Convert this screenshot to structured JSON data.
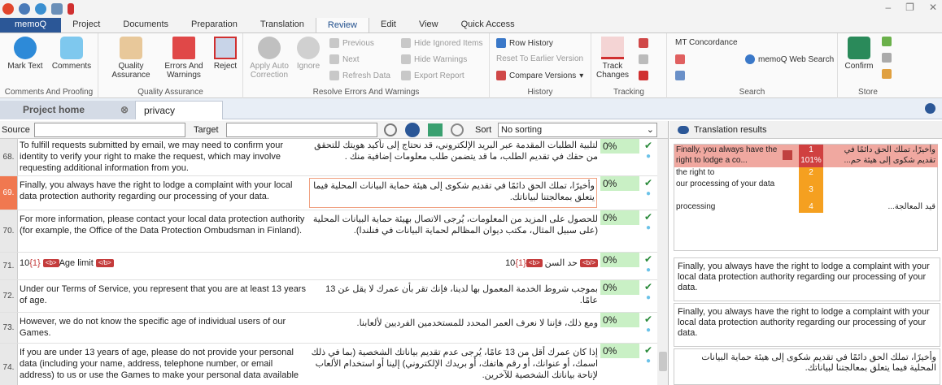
{
  "app": {
    "menu_tab": "memoQ"
  },
  "tabs": [
    "Project",
    "Documents",
    "Preparation",
    "Translation",
    "Review",
    "Edit",
    "View",
    "Quick Access"
  ],
  "active_tab": "Review",
  "ribbon": {
    "comments": {
      "mark_text": "Mark Text",
      "comments": "Comments",
      "group": "Comments And Proofing"
    },
    "qa": {
      "quality_assurance": "Quality Assurance",
      "errors_warnings": "Errors And Warnings",
      "reject": "Reject",
      "group": "Quality Assurance"
    },
    "resolve": {
      "apply_auto": "Apply Auto Correction",
      "ignore": "Ignore",
      "previous": "Previous",
      "next": "Next",
      "refresh": "Refresh Data",
      "hide_ignored": "Hide Ignored Items",
      "hide_warnings": "Hide Warnings",
      "export": "Export Report",
      "group": "Resolve Errors And Warnings"
    },
    "history": {
      "row_history": "Row History",
      "reset": "Reset To Earlier Version",
      "compare": "Compare Versions",
      "group": "History"
    },
    "tracking": {
      "track_changes": "Track Changes",
      "group": "Tracking"
    },
    "search": {
      "mt_concordance": "MT Concordance",
      "web_search": "memoQ Web Search",
      "group": "Search"
    },
    "store": {
      "confirm": "Confirm",
      "group": "Store"
    }
  },
  "doc_tabs": {
    "home": "Project home",
    "doc": "privacy policy.txt"
  },
  "filter": {
    "source_label": "Source",
    "target_label": "Target",
    "sort_label": "Sort",
    "sort_value": "No sorting"
  },
  "rows": [
    {
      "num": "68.",
      "source": "To fulfill requests submitted by email, we may need to confirm your identity to verify your right to make the request, which may involve requesting additional information from you.",
      "target": "لتلبية الطلبات المقدمة عبر البريد الإلكتروني، قد نحتاج إلى تأكيد هويتك للتحقق من حقك في تقديم الطلب، ما قد يتضمن طلب معلومات إضافية منك .",
      "pct": "0%"
    },
    {
      "num": "69.",
      "source": "Finally, you always have the right to lodge a complaint with your local data protection authority regarding our processing of your data.",
      "target": "وأخيرًا، تملك الحق دائمًا في تقديم شكوى إلى هيئة حماية البيانات المحلية فيما يتعلق بمعالجتنا لبياناتك.",
      "pct": "0%"
    },
    {
      "num": "70.",
      "source": "For more information, please contact your local data protection authority (for example, the Office of the Data Protection Ombudsman in Finland).",
      "target": "للحصول على المزيد من المعلومات، يُرجى الاتصال بهيئة حماية البيانات المحلية (على سبيل المثال، مكتب ديوان المظالم لحماية البيانات في فنلندا).",
      "pct": "0%"
    },
    {
      "num": "71.",
      "source": "Age limit",
      "target": "حد السن",
      "pct": "0%",
      "src_prefix": "10",
      "tag_num": "{1}",
      "tag_open": "<b>",
      "tag_close": "</b>",
      "tgt_suffix": "10"
    },
    {
      "num": "72.",
      "source": "Under our Terms of Service, you represent that you are at least 13 years of age.",
      "target": "بموجب شروط الخدمة المعمول بها لدينا، فإنك تقر بأن عمرك لا يقل عن 13 عامًا.",
      "pct": "0%"
    },
    {
      "num": "73.",
      "source": "However, we do not know the specific age of individual users of our Games.",
      "target": "ومع ذلك، فإننا لا نعرف العمر المحدد للمستخدمين الفرديين لألعابنا.",
      "pct": "0%"
    },
    {
      "num": "74.",
      "source": "If you are under 13 years of age, please do not provide your personal data (including your name, address, telephone number, or email address) to us or use the Games to make your personal data available",
      "target": "إذا كان عمرك أقل من 13 عامًا، يُرجى عدم تقديم بياناتك الشخصية (بما في ذلك اسمك، أو عنوانك، أو رقم هاتفك، أو بريدك الإلكتروني) إلينا أو استخدام الألعاب لإتاحة بياناتك الشخصية للآخرين.",
      "pct": "0%"
    }
  ],
  "results": {
    "title": "Translation results",
    "items": [
      {
        "src": "Finally, you always have the right to lodge a co...",
        "num": "1",
        "pct": "101%",
        "tgt": "وأخيرًا، تملك الحق دائمًا في تقديم شكوى إلى هيئة حم..."
      },
      {
        "src": "the right to",
        "num": "2",
        "tgt": ""
      },
      {
        "src": "our processing of your data",
        "num": "3",
        "tgt": ""
      },
      {
        "src": "processing",
        "num": "4",
        "tgt": "قيد المعالجة..."
      }
    ],
    "preview1": "Finally, you always have the right to lodge a complaint with your local data protection authority regarding our processing of your data.",
    "preview2": "Finally, you always have the right to lodge a complaint with your local data protection authority regarding our processing of your data.",
    "preview3": "وأخيرًا، تملك الحق دائمًا في تقديم شكوى إلى هيئة حماية البيانات المحلية فيما يتعلق بمعالجتنا لبياناتك."
  }
}
